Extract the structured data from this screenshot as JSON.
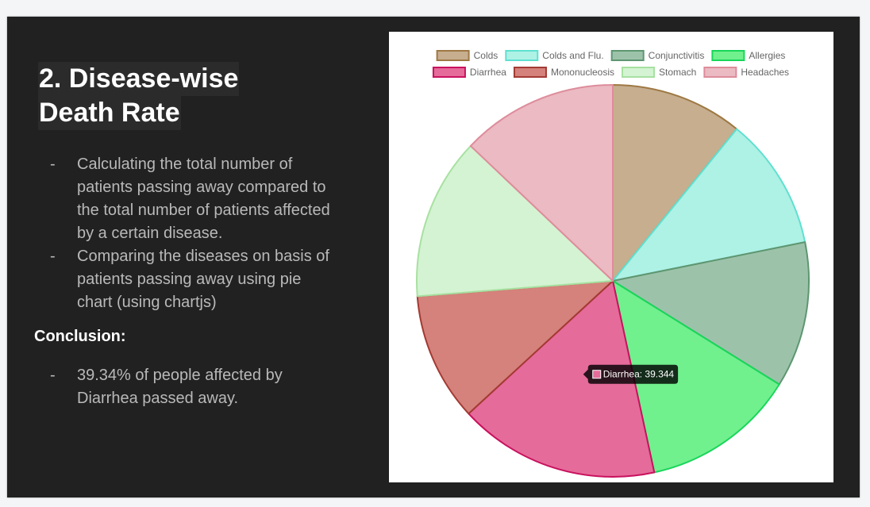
{
  "slide": {
    "title_line1": "2. Disease-wise",
    "title_line2": "Death Rate",
    "bullets": [
      "Calculating the total number of patients passing away compared to the total number of patients affected by a certain disease.",
      "Comparing the diseases on basis of patients passing away using pie chart (using chartjs)"
    ],
    "conclusion_heading": "Conclusion:",
    "conclusion_bullets": [
      "39.34% of people affected by Diarrhea passed away."
    ]
  },
  "chart_data": {
    "type": "pie",
    "title": "",
    "categories": [
      "Colds",
      "Colds and Flu.",
      "Conjunctivitis",
      "Allergies",
      "Diarrhea",
      "Mononucleosis",
      "Stomach",
      "Headaches"
    ],
    "values": [
      25.9,
      26.0,
      28.6,
      30.3,
      39.344,
      25.2,
      31.7,
      30.7
    ],
    "colors": {
      "fill": [
        "#c6ae8f",
        "#aef1e5",
        "#9cc3aa",
        "#71f08e",
        "#e56b9a",
        "#d4827b",
        "#d4f3d2",
        "#ebbac3"
      ],
      "stroke": [
        "#9e7843",
        "#5fe0d0",
        "#5e9671",
        "#18d65a",
        "#c9115e",
        "#a33a33",
        "#a7e1a1",
        "#de8c9b"
      ]
    },
    "legend_position": "top",
    "tooltip": {
      "category": "Diarrhea",
      "text": "Diarrhea: 39.344"
    }
  }
}
